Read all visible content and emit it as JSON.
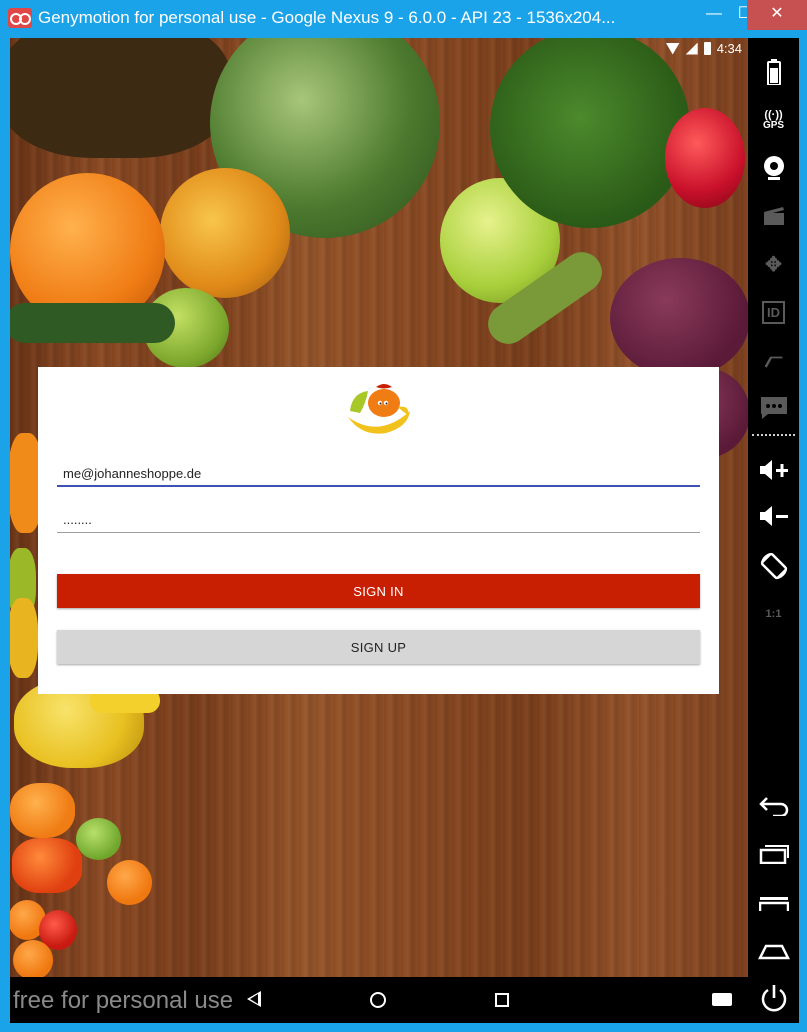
{
  "window": {
    "title": "Genymotion for personal use - Google Nexus 9 - 6.0.0 - API 23 - 1536x204...",
    "minimize_glyph": "—",
    "maximize_glyph": "☐",
    "close_glyph": "✕"
  },
  "statusbar": {
    "time": "4:34"
  },
  "login": {
    "email_value": "me@johanneshoppe.de",
    "password_value": "........",
    "sign_in_label": "SIGN IN",
    "sign_up_label": "SIGN UP"
  },
  "android_nav": {
    "watermark": "free for personal use"
  },
  "sidebar": {
    "gps_label": "GPS",
    "id_label": "ID",
    "pixel_ratio_label": "1:1",
    "icons": [
      "battery-icon",
      "gps-icon",
      "webcam-icon",
      "capture-icon",
      "dpad-icon",
      "identifiers-icon",
      "cast-icon",
      "sms-icon",
      "volume-up-icon",
      "volume-down-icon",
      "rotate-icon",
      "pixel-perfect-icon",
      "back-icon",
      "recent-apps-icon",
      "menu-icon",
      "home-icon",
      "power-icon"
    ]
  },
  "colors": {
    "window_frame": "#1aa3e8",
    "sign_in_button": "#c81e02",
    "sign_up_button": "#d6d6d6",
    "input_focus": "#3f51b5"
  }
}
